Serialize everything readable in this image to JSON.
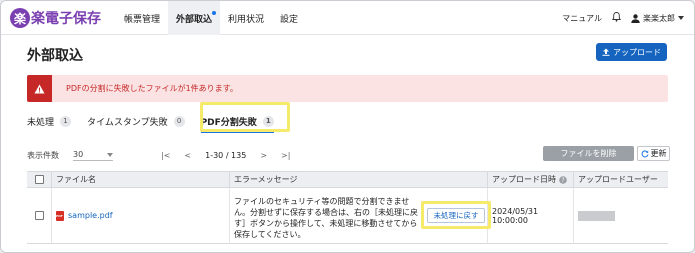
{
  "header": {
    "logo_mark": "楽",
    "logo_text": "楽電子保存",
    "nav": [
      {
        "label": "帳票管理"
      },
      {
        "label": "外部取込"
      },
      {
        "label": "利用状況"
      },
      {
        "label": "設定"
      }
    ],
    "manual": "マニュアル",
    "user": "楽楽太郎"
  },
  "page": {
    "title": "外部取込",
    "upload_label": "アップロード"
  },
  "alert": {
    "text": "PDFの分割に失敗したファイルが1件あります。"
  },
  "tabs": [
    {
      "label": "未処理",
      "count": "1"
    },
    {
      "label": "タイムスタンプ失敗",
      "count": "0"
    },
    {
      "label": "PDF分割失敗",
      "count": "1"
    }
  ],
  "toolbar": {
    "per_page_label": "表示件数",
    "per_page_value": "30",
    "first": "|<",
    "prev": "<",
    "range": "1-30",
    "total": "/ 135",
    "next": ">",
    "last": ">|",
    "delete_label": "ファイルを削除",
    "refresh_label": "更新"
  },
  "table": {
    "columns": [
      "ファイル名",
      "エラーメッセージ",
      "アップロード日時",
      "アップロードユーザー"
    ],
    "rows": [
      {
        "file": "sample.pdf",
        "error": "ファイルのセキュリティ等の問題で分割できません。分割せずに保存する場合は、右の［未処理に戻す］ボタンから操作して、未処理に移動させてから保存してください。",
        "action": "未処理に戻す",
        "datetime": "2024/05/31 10:00:00"
      }
    ]
  },
  "colors": {
    "brand": "#7a3fb0",
    "primary": "#1565c0",
    "alert": "#c62828",
    "highlight": "#f5ea6a"
  }
}
